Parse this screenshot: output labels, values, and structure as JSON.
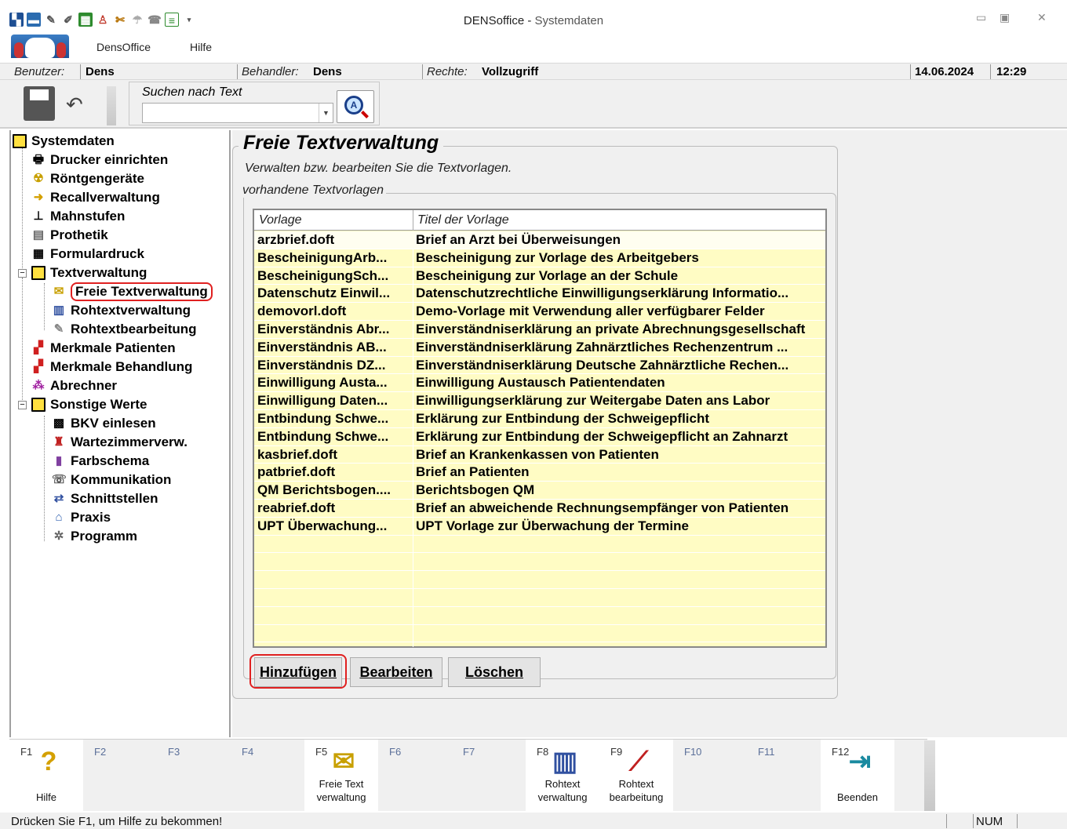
{
  "window": {
    "title_app": "DENSoffice -",
    "title_doc": "Systemdaten"
  },
  "menu": {
    "items": [
      "DensOffice",
      "Hilfe"
    ]
  },
  "userbar": {
    "user_label": "Benutzer:",
    "user_value": "Dens",
    "handler_label": "Behandler:",
    "handler_value": "Dens",
    "rights_label": "Rechte:",
    "rights_value": "Vollzugriff",
    "date": "14.06.2024",
    "time": "12:29"
  },
  "toolbar": {
    "search_label": "Suchen nach Text",
    "search_value": "",
    "save_icon": "save-disk-icon",
    "undo_icon": "undo-icon",
    "search_icon": "find-text-icon"
  },
  "tree": {
    "root": "Systemdaten",
    "items": [
      {
        "label": "Drucker einrichten",
        "icon": "printer-icon"
      },
      {
        "label": "Röntgengeräte",
        "icon": "xray-icon"
      },
      {
        "label": "Recallverwaltung",
        "icon": "recall-icon"
      },
      {
        "label": "Mahnstufen",
        "icon": "reminder-levels-icon"
      },
      {
        "label": "Prothetik",
        "icon": "prosthetics-icon"
      },
      {
        "label": "Formulardruck",
        "icon": "form-print-icon"
      }
    ],
    "textverwaltung": {
      "label": "Textverwaltung",
      "children": [
        {
          "label": "Freie Textverwaltung",
          "icon": "free-text-icon"
        },
        {
          "label": "Rohtextverwaltung",
          "icon": "raw-text-icon"
        },
        {
          "label": "Rohtextbearbeitung",
          "icon": "raw-text-edit-icon"
        }
      ]
    },
    "items2": [
      {
        "label": "Merkmale Patienten",
        "icon": "patient-attributes-icon"
      },
      {
        "label": "Merkmale Behandlung",
        "icon": "treatment-attributes-icon"
      },
      {
        "label": "Abrechner",
        "icon": "billing-icon"
      }
    ],
    "sonstige": {
      "label": "Sonstige Werte",
      "children": [
        {
          "label": "BKV einlesen",
          "icon": "bkv-icon"
        },
        {
          "label": "Wartezimmerverw.",
          "icon": "waiting-room-icon"
        },
        {
          "label": "Farbschema",
          "icon": "color-scheme-icon"
        },
        {
          "label": "Kommunikation",
          "icon": "communication-icon"
        },
        {
          "label": "Schnittstellen",
          "icon": "interfaces-icon"
        },
        {
          "label": "Praxis",
          "icon": "practice-icon"
        },
        {
          "label": "Programm",
          "icon": "program-icon"
        }
      ]
    }
  },
  "main": {
    "title": "Freie Textverwaltung",
    "description": "Verwalten bzw. bearbeiten Sie die Textvorlagen.",
    "group_label": "vorhandene Textvorlagen",
    "columns": [
      "Vorlage",
      "Titel der Vorlage"
    ],
    "rows": [
      [
        "arzbrief.doft",
        "Brief an Arzt bei Überweisungen"
      ],
      [
        "BescheinigungArb...",
        "Bescheinigung zur Vorlage des Arbeitgebers"
      ],
      [
        "BescheinigungSch...",
        "Bescheinigung zur Vorlage an der Schule"
      ],
      [
        "Datenschutz Einwil...",
        "Datenschutzrechtliche Einwilligungserklärung Informatio..."
      ],
      [
        "demovorl.doft",
        "Demo-Vorlage mit Verwendung aller verfügbarer Felder"
      ],
      [
        "Einverständnis Abr...",
        "Einverständniserklärung an private Abrechnungsgesellschaft"
      ],
      [
        "Einverständnis AB...",
        "Einverständniserklärung Zahnärztliches Rechenzentrum ..."
      ],
      [
        "Einverständnis DZ...",
        "Einverständniserklärung Deutsche Zahnärztliche Rechen..."
      ],
      [
        "Einwilligung Austa...",
        "Einwilligung Austausch Patientendaten"
      ],
      [
        "Einwilligung Daten...",
        "Einwilligungserklärung zur Weitergabe Daten ans Labor"
      ],
      [
        "Entbindung Schwe...",
        "Erklärung zur Entbindung der Schweigepflicht"
      ],
      [
        "Entbindung Schwe...",
        "Erklärung zur Entbindung der Schweigepflicht an Zahnarzt"
      ],
      [
        "kasbrief.doft",
        "Brief an Krankenkassen von Patienten"
      ],
      [
        "patbrief.doft",
        "Brief an Patienten"
      ],
      [
        "QM Berichtsbogen....",
        "Berichtsbogen QM"
      ],
      [
        "reabrief.doft",
        "Brief an abweichende Rechnungsempfänger von Patienten"
      ],
      [
        "UPT Überwachung...",
        "UPT Vorlage zur Überwachung der Termine"
      ]
    ],
    "buttons": {
      "add": "Hinzufügen",
      "edit": "Bearbeiten",
      "delete": "Löschen"
    }
  },
  "fkeys": [
    {
      "key": "F1",
      "label1": "",
      "label2": "Hilfe",
      "icon": "help-icon"
    },
    {
      "key": "F2",
      "label1": "",
      "label2": "",
      "icon": ""
    },
    {
      "key": "F3",
      "label1": "",
      "label2": "",
      "icon": ""
    },
    {
      "key": "F4",
      "label1": "",
      "label2": "",
      "icon": ""
    },
    {
      "key": "F5",
      "label1": "Freie Text",
      "label2": "verwaltung",
      "icon": "free-text-icon"
    },
    {
      "key": "F6",
      "label1": "",
      "label2": "",
      "icon": ""
    },
    {
      "key": "F7",
      "label1": "",
      "label2": "",
      "icon": ""
    },
    {
      "key": "F8",
      "label1": "Rohtext",
      "label2": "verwaltung",
      "icon": "raw-text-icon"
    },
    {
      "key": "F9",
      "label1": "Rohtext",
      "label2": "bearbeitung",
      "icon": "raw-text-edit-icon"
    },
    {
      "key": "F10",
      "label1": "",
      "label2": "",
      "icon": ""
    },
    {
      "key": "F11",
      "label1": "",
      "label2": "",
      "icon": ""
    },
    {
      "key": "F12",
      "label1": "",
      "label2": "Beenden",
      "icon": "exit-door-icon"
    }
  ],
  "status": {
    "text": "Drücken Sie F1, um Hilfe zu bekommen!",
    "num": "NUM"
  },
  "colors": {
    "grid_bg": "#fffcc4",
    "highlight_ring": "#e02020",
    "folder": "#ffe040"
  }
}
